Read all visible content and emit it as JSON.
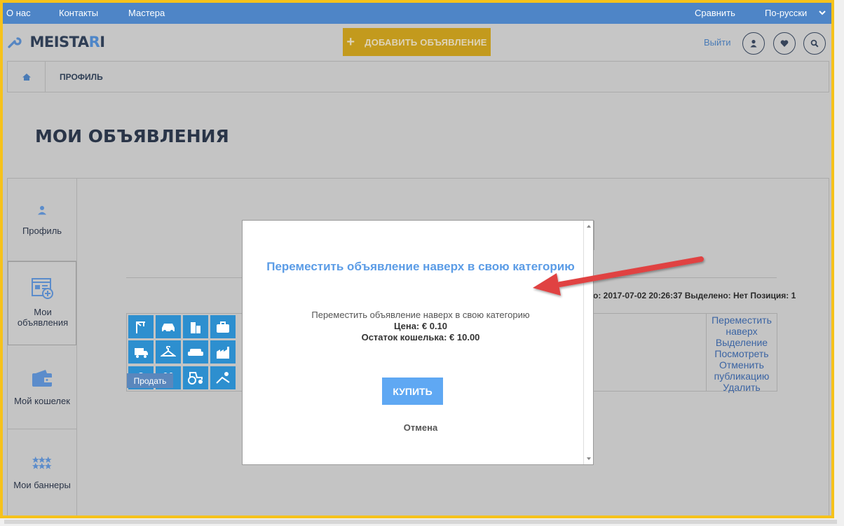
{
  "topbar": {
    "links": [
      "О нас",
      "Контакты",
      "Мастера"
    ],
    "compare": "Сравнить",
    "language": "По-русски"
  },
  "header": {
    "logo_main": "MEISTA",
    "logo_r": "R",
    "logo_i": "I",
    "add_button": "ДОБАВИТЬ ОБЪЯВЛЕНИЕ",
    "logout": "Выйти"
  },
  "breadcrumb": {
    "current": "ПРОФИЛЬ"
  },
  "page_title": "МОИ ОБЪЯВЛЕНИЯ",
  "sidebar": {
    "items": [
      {
        "label": "Профиль",
        "icon": "user-icon"
      },
      {
        "label": "Мои объявления",
        "icon": "ads-icon"
      },
      {
        "label": "Мой кошелек",
        "icon": "wallet-icon"
      },
      {
        "label": "Мои баннеры",
        "icon": "stars-icon"
      }
    ]
  },
  "listing": {
    "meta": "о: 2017-07-02 20:26:37 Выделено: Нет Позиция: 1",
    "sell_label": "Продать",
    "actions": [
      "Переместить наверх",
      "Выделение",
      "Посмотреть",
      "Отменить публикацию",
      "Удалить"
    ]
  },
  "modal": {
    "title": "Переместить объявление наверх в свою категорию",
    "description": "Переместить объявление наверх в свою категорию",
    "price": "Цена: € 0.10",
    "wallet": "Остаток кошелька: € 10.00",
    "buy": "КУПИТЬ",
    "cancel": "Отмена"
  },
  "colors": {
    "topbar": "#4e85c7",
    "accent_yellow": "#c39a1d",
    "modal_title": "#5b9ce6",
    "buy_button": "#5fa8f3",
    "arrow": "#e04242",
    "frame": "#f6c21b"
  }
}
